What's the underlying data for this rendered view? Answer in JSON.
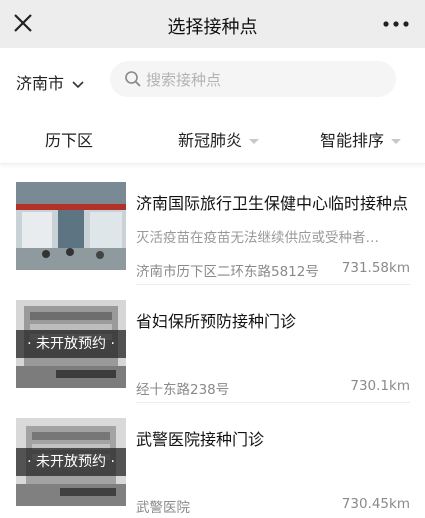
{
  "header": {
    "title": "选择接种点",
    "close_icon": "close-icon",
    "more_icon": "more-icon"
  },
  "search": {
    "city": "济南市",
    "placeholder": "搜索接种点"
  },
  "filters": {
    "district": "历下区",
    "vaccine": "新冠肺炎",
    "sort": "智能排序"
  },
  "sites": [
    {
      "name": "济南国际旅行卫生保健中心临时接种点",
      "description": "灭活疫苗在疫苗无法继续供应或受种者…",
      "address": "济南市历下区二环东路5812号",
      "distance": "731.58km",
      "badge": ""
    },
    {
      "name": "省妇保所预防接种门诊",
      "description": "",
      "address": "经十东路238号",
      "distance": "730.1km",
      "badge": "· 未开放预约 ·"
    },
    {
      "name": "武警医院接种门诊",
      "description": "",
      "address": "武警医院",
      "distance": "730.45km",
      "badge": "· 未开放预约 ·"
    }
  ],
  "colors": {
    "header_bg": "#ededed",
    "search_bg": "#f5f5f5",
    "secondary_text": "#999999"
  }
}
